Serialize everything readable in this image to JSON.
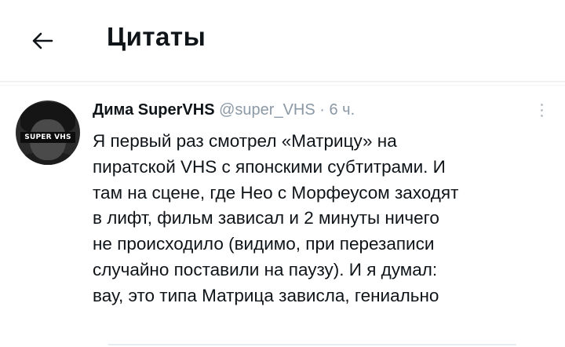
{
  "header": {
    "back_icon": "arrow-left-icon",
    "title": "Цитаты"
  },
  "tweet": {
    "author_name": "Дима SuperVHS",
    "handle": "@super_VHS",
    "separator": "·",
    "time": "6 ч.",
    "avatar_text": "SUPER VHS",
    "more_icon": "more-vertical-icon",
    "text": "Я первый раз смотрел «Матрицу» на\nпиратской VHS с японскими субтитрами. И\nтам на сцене, где Нео с Морфеусом заходят\nв лифт, фильм зависал и 2 минуты ничего\nне происходило (видимо, при перезаписи\nслучайно поставили на паузу). И я думал:\nвау, это типа Матрица зависла, гениально"
  }
}
